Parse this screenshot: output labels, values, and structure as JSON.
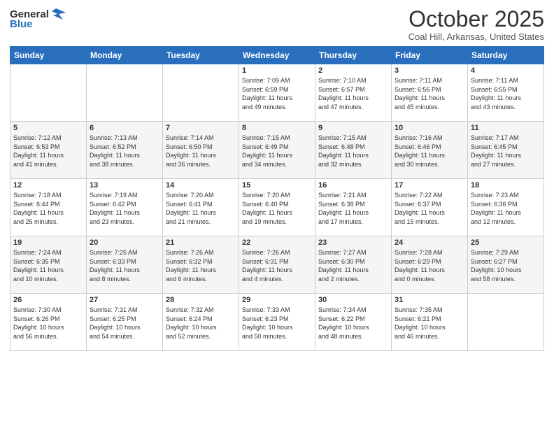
{
  "logo": {
    "general": "General",
    "blue": "Blue"
  },
  "header": {
    "month": "October 2025",
    "location": "Coal Hill, Arkansas, United States"
  },
  "weekdays": [
    "Sunday",
    "Monday",
    "Tuesday",
    "Wednesday",
    "Thursday",
    "Friday",
    "Saturday"
  ],
  "weeks": [
    [
      {
        "day": "",
        "info": ""
      },
      {
        "day": "",
        "info": ""
      },
      {
        "day": "",
        "info": ""
      },
      {
        "day": "1",
        "info": "Sunrise: 7:09 AM\nSunset: 6:59 PM\nDaylight: 11 hours\nand 49 minutes."
      },
      {
        "day": "2",
        "info": "Sunrise: 7:10 AM\nSunset: 6:57 PM\nDaylight: 11 hours\nand 47 minutes."
      },
      {
        "day": "3",
        "info": "Sunrise: 7:11 AM\nSunset: 6:56 PM\nDaylight: 11 hours\nand 45 minutes."
      },
      {
        "day": "4",
        "info": "Sunrise: 7:11 AM\nSunset: 6:55 PM\nDaylight: 11 hours\nand 43 minutes."
      }
    ],
    [
      {
        "day": "5",
        "info": "Sunrise: 7:12 AM\nSunset: 6:53 PM\nDaylight: 11 hours\nand 41 minutes."
      },
      {
        "day": "6",
        "info": "Sunrise: 7:13 AM\nSunset: 6:52 PM\nDaylight: 11 hours\nand 38 minutes."
      },
      {
        "day": "7",
        "info": "Sunrise: 7:14 AM\nSunset: 6:50 PM\nDaylight: 11 hours\nand 36 minutes."
      },
      {
        "day": "8",
        "info": "Sunrise: 7:15 AM\nSunset: 6:49 PM\nDaylight: 11 hours\nand 34 minutes."
      },
      {
        "day": "9",
        "info": "Sunrise: 7:15 AM\nSunset: 6:48 PM\nDaylight: 11 hours\nand 32 minutes."
      },
      {
        "day": "10",
        "info": "Sunrise: 7:16 AM\nSunset: 6:46 PM\nDaylight: 11 hours\nand 30 minutes."
      },
      {
        "day": "11",
        "info": "Sunrise: 7:17 AM\nSunset: 6:45 PM\nDaylight: 11 hours\nand 27 minutes."
      }
    ],
    [
      {
        "day": "12",
        "info": "Sunrise: 7:18 AM\nSunset: 6:44 PM\nDaylight: 11 hours\nand 25 minutes."
      },
      {
        "day": "13",
        "info": "Sunrise: 7:19 AM\nSunset: 6:42 PM\nDaylight: 11 hours\nand 23 minutes."
      },
      {
        "day": "14",
        "info": "Sunrise: 7:20 AM\nSunset: 6:41 PM\nDaylight: 11 hours\nand 21 minutes."
      },
      {
        "day": "15",
        "info": "Sunrise: 7:20 AM\nSunset: 6:40 PM\nDaylight: 11 hours\nand 19 minutes."
      },
      {
        "day": "16",
        "info": "Sunrise: 7:21 AM\nSunset: 6:38 PM\nDaylight: 11 hours\nand 17 minutes."
      },
      {
        "day": "17",
        "info": "Sunrise: 7:22 AM\nSunset: 6:37 PM\nDaylight: 11 hours\nand 15 minutes."
      },
      {
        "day": "18",
        "info": "Sunrise: 7:23 AM\nSunset: 6:36 PM\nDaylight: 11 hours\nand 12 minutes."
      }
    ],
    [
      {
        "day": "19",
        "info": "Sunrise: 7:24 AM\nSunset: 6:35 PM\nDaylight: 11 hours\nand 10 minutes."
      },
      {
        "day": "20",
        "info": "Sunrise: 7:25 AM\nSunset: 6:33 PM\nDaylight: 11 hours\nand 8 minutes."
      },
      {
        "day": "21",
        "info": "Sunrise: 7:26 AM\nSunset: 6:32 PM\nDaylight: 11 hours\nand 6 minutes."
      },
      {
        "day": "22",
        "info": "Sunrise: 7:26 AM\nSunset: 6:31 PM\nDaylight: 11 hours\nand 4 minutes."
      },
      {
        "day": "23",
        "info": "Sunrise: 7:27 AM\nSunset: 6:30 PM\nDaylight: 11 hours\nand 2 minutes."
      },
      {
        "day": "24",
        "info": "Sunrise: 7:28 AM\nSunset: 6:29 PM\nDaylight: 11 hours\nand 0 minutes."
      },
      {
        "day": "25",
        "info": "Sunrise: 7:29 AM\nSunset: 6:27 PM\nDaylight: 10 hours\nand 58 minutes."
      }
    ],
    [
      {
        "day": "26",
        "info": "Sunrise: 7:30 AM\nSunset: 6:26 PM\nDaylight: 10 hours\nand 56 minutes."
      },
      {
        "day": "27",
        "info": "Sunrise: 7:31 AM\nSunset: 6:25 PM\nDaylight: 10 hours\nand 54 minutes."
      },
      {
        "day": "28",
        "info": "Sunrise: 7:32 AM\nSunset: 6:24 PM\nDaylight: 10 hours\nand 52 minutes."
      },
      {
        "day": "29",
        "info": "Sunrise: 7:33 AM\nSunset: 6:23 PM\nDaylight: 10 hours\nand 50 minutes."
      },
      {
        "day": "30",
        "info": "Sunrise: 7:34 AM\nSunset: 6:22 PM\nDaylight: 10 hours\nand 48 minutes."
      },
      {
        "day": "31",
        "info": "Sunrise: 7:35 AM\nSunset: 6:21 PM\nDaylight: 10 hours\nand 46 minutes."
      },
      {
        "day": "",
        "info": ""
      }
    ]
  ]
}
